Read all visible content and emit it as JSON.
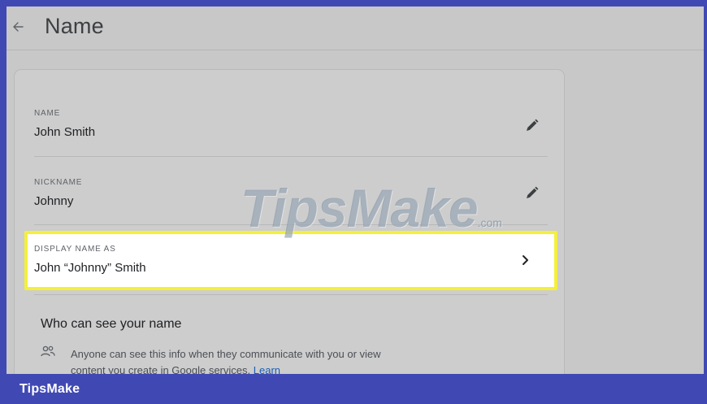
{
  "header": {
    "back_icon": "arrow-back-icon",
    "title": "Name"
  },
  "card": {
    "name_row": {
      "label": "NAME",
      "value": "John Smith",
      "action_icon": "pencil-icon"
    },
    "nickname_row": {
      "label": "NICKNAME",
      "value": "Johnny",
      "action_icon": "pencil-icon"
    },
    "display_row": {
      "label": "DISPLAY NAME AS",
      "value": "John “Johnny” Smith",
      "action_icon": "chevron-right-icon",
      "highlight_color": "#f4f03a"
    },
    "visibility": {
      "heading": "Who can see your name",
      "icon": "people-icon",
      "text": "Anyone can see this info when they communicate with you or view content you create in Google services.",
      "link": "Learn"
    }
  },
  "watermark": {
    "main": "TipsMake",
    "suffix": ".com"
  },
  "footer": {
    "brand": "TipsMake",
    "color": "#4049b3"
  }
}
